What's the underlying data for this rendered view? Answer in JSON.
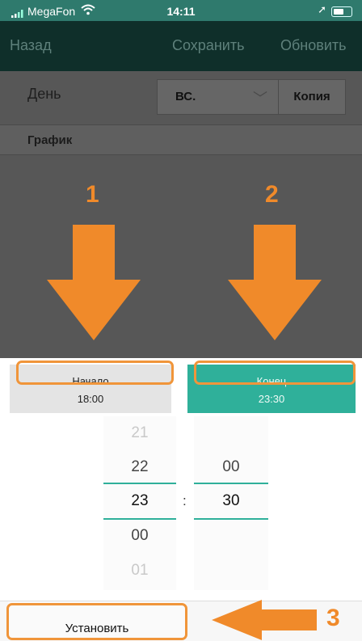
{
  "status": {
    "carrier": "MegaFon",
    "time": "14:11"
  },
  "nav": {
    "back": "Назад",
    "save": "Сохранить",
    "refresh": "Обновить"
  },
  "form": {
    "day_label": "День",
    "day_value": "ВС.",
    "copy_button": "Копия",
    "schedule_label": "График"
  },
  "annotations": {
    "n1": "1",
    "n2": "2",
    "n3": "3"
  },
  "picker": {
    "start_label": "Начало",
    "start_time": "18:00",
    "end_label": "Конец",
    "end_time": "23:30",
    "hours": [
      "21",
      "22",
      "23",
      "00",
      "01"
    ],
    "minutes": [
      "00",
      "30"
    ],
    "separator": ":",
    "set_button": "Установить"
  },
  "colors": {
    "teal": "#2fb09a",
    "orange": "#f08a2a",
    "dark_nav": "#0f2f2a"
  }
}
